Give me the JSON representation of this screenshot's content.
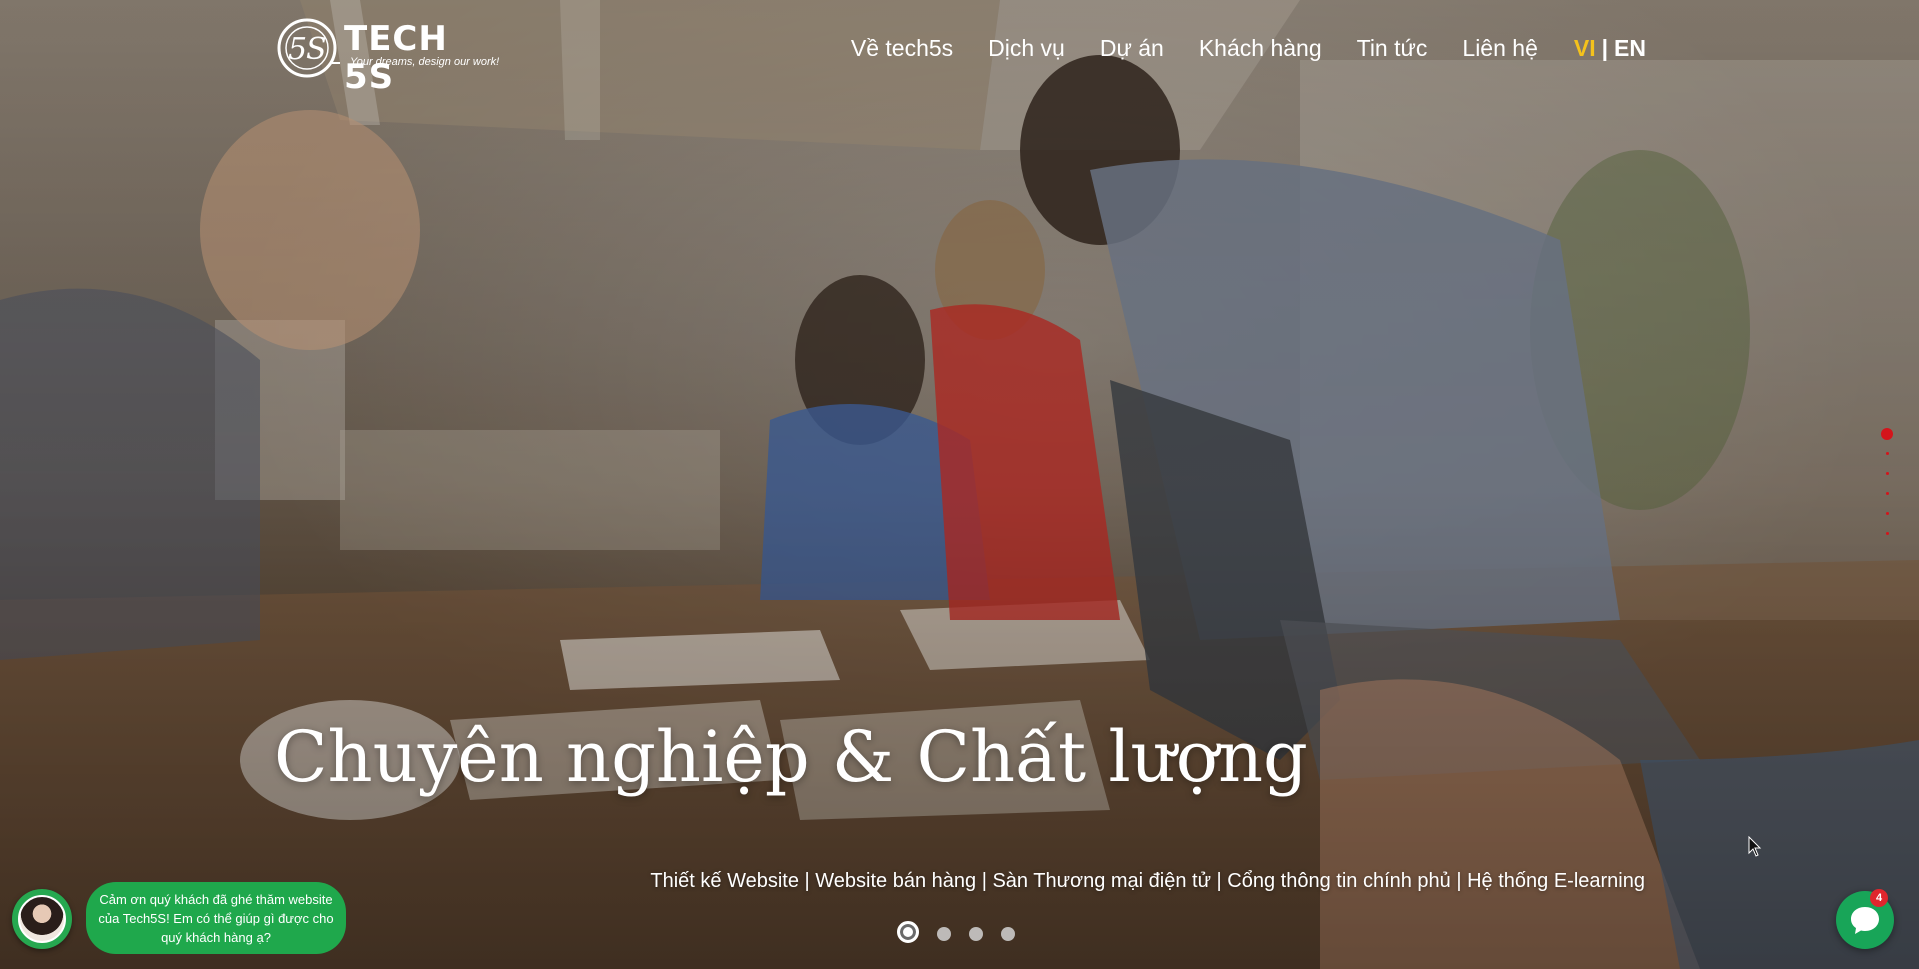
{
  "header": {
    "logo_text": "TECH 5S",
    "logo_tagline": "Your dreams, design our work!",
    "nav": [
      {
        "label": "Về tech5s"
      },
      {
        "label": "Dịch vụ"
      },
      {
        "label": "Dự án"
      },
      {
        "label": "Khách hàng"
      },
      {
        "label": "Tin tức"
      },
      {
        "label": "Liên hệ"
      }
    ],
    "lang": {
      "vi": "VI",
      "sep": "|",
      "en": "EN",
      "active": "VI"
    }
  },
  "hero": {
    "headline": "Chuyên nghiệp & Chất lượng",
    "services": "Thiết kế Website | Website bán hàng | Sàn Thương mại điện tử | Cổng thông tin chính phủ | Hệ thống E-learning",
    "slides_total": 4,
    "active_slide": 1
  },
  "side_nav": {
    "sections_total": 6,
    "active_section": 1
  },
  "chat": {
    "greeting": "Cảm ơn quý khách đã ghé thăm website của Tech5S! Em có thể giúp gì được cho quý khách hàng ạ?",
    "badge_count": "4"
  },
  "colors": {
    "accent_yellow": "#f4c21c",
    "accent_red": "#d4141b",
    "chat_green": "#1fa84c",
    "badge_red": "#e0262d"
  },
  "icons": {
    "logo": "tech5s-logo-icon",
    "chat_avatar": "agent-avatar-icon",
    "chat_button": "chat-bubble-icon",
    "cursor": "mouse-pointer-icon"
  }
}
